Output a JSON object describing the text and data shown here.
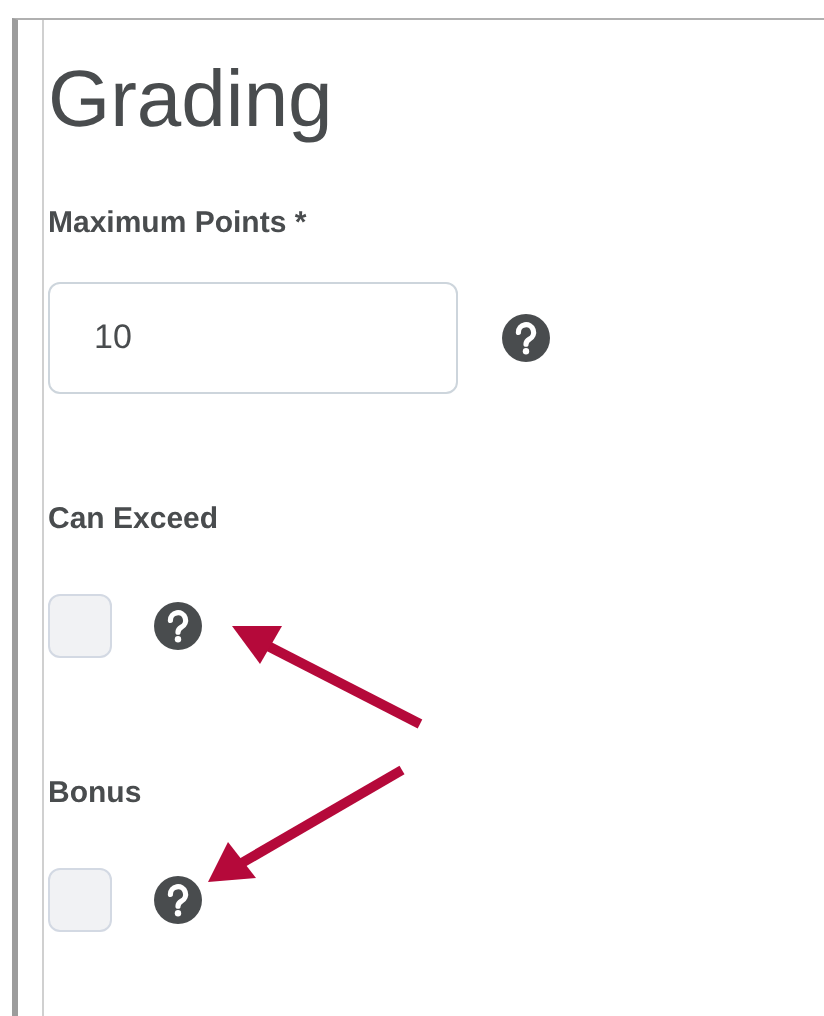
{
  "heading": "Grading",
  "max_points": {
    "label": "Maximum Points *",
    "value": "10"
  },
  "options": [
    {
      "label": "Can Exceed",
      "checked": false
    },
    {
      "label": "Bonus",
      "checked": false
    }
  ]
}
